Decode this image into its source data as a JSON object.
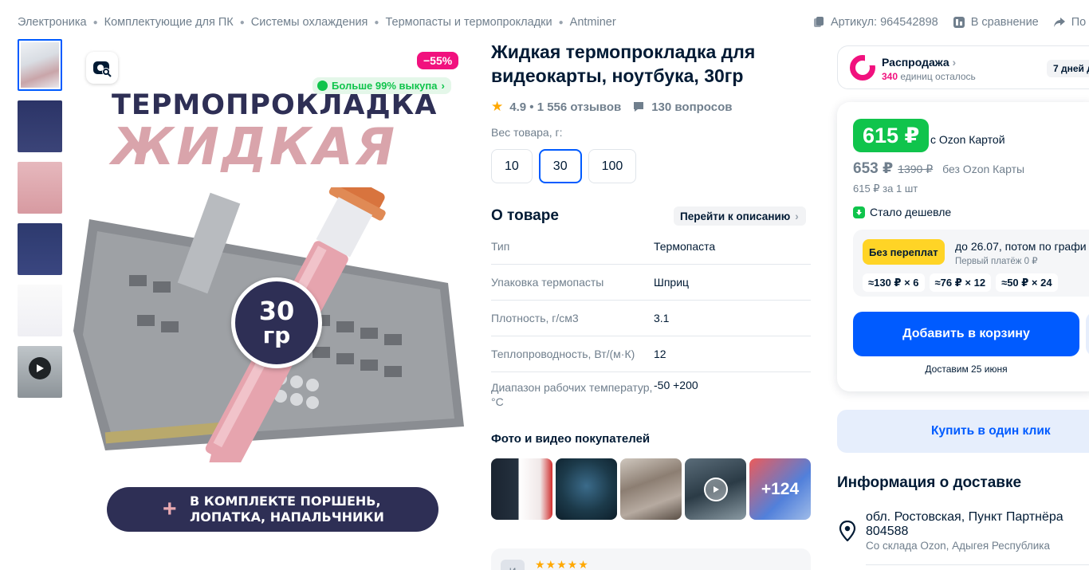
{
  "breadcrumb": [
    "Электроника",
    "Комплектующие для ПК",
    "Системы охлаждения",
    "Термопасты и термопрокладки",
    "Antminer"
  ],
  "top_actions": {
    "article": "Артикул: 964542898",
    "compare": "В сравнение",
    "share": "По"
  },
  "gallery": {
    "discount_badge": "−55%",
    "buyout_badge": "Больше 99% выкупа",
    "image_text": {
      "line1": "ТЕРМОПРОКЛАДКА",
      "line2": "ЖИДКАЯ",
      "badge_top": "30",
      "badge_bottom": "гр",
      "plus": "+",
      "bottom_line1": "В КОМПЛЕКТЕ ПОРШЕНЬ,",
      "bottom_line2": "ЛОПАТКА, НАПАЛЬЧНИКИ"
    }
  },
  "product": {
    "title": "Жидкая термопрокладка для видеокарты, ноутбука, 30гр",
    "rating": "4.9 • 1 556 отзывов",
    "questions": "130 вопросов",
    "weight_label": "Вес товара, г:",
    "weights": [
      "10",
      "30",
      "100"
    ],
    "selected_weight": "30"
  },
  "about": {
    "title": "О товаре",
    "to_description": "Перейти к описанию",
    "specs": [
      {
        "k": "Тип",
        "v": "Термопаста"
      },
      {
        "k": "Упаковка термопасты",
        "v": "Шприц"
      },
      {
        "k": "Плотность, г/см3",
        "v": "3.1"
      },
      {
        "k": "Теплопроводность, Вт/(м·К)",
        "v": "12"
      },
      {
        "k": "Диапазон рабочих температур, °С",
        "v": "-50 +200"
      }
    ]
  },
  "buyer_media": {
    "title": "Фото и видео покупателей",
    "more": "+124"
  },
  "sale": {
    "title": "Распродажа",
    "count": "340",
    "left_text": "единиц осталось",
    "days": "7 дней д"
  },
  "price": {
    "ozon_card_price": "615 ₽",
    "ozon_card_label": "с Ozon Картой",
    "price": "653 ₽",
    "old_price": "1390 ₽",
    "no_card_label": "без Ozon Карты",
    "unit_price": "615 ₽ за 1 шт",
    "cheaper": "Стало дешевле",
    "installment": {
      "badge": "Без переплат",
      "text": "до 26.07, потом по графи",
      "first_payment": "Первый платёж 0 ₽",
      "chips": [
        "≈130 ₽ × 6",
        "≈76 ₽ × 12",
        "≈50 ₽ × 24"
      ]
    },
    "add_to_cart": "Добавить в корзину",
    "deliver_date": "Доставим 25 июня"
  },
  "one_click": "Купить в один клик",
  "delivery": {
    "title": "Информация о доставке",
    "address": "обл. Ростовская, Пункт Партнёра 804588",
    "warehouse": "Со склада Ozon, Адыгея Республика"
  },
  "colors": {
    "ozon_blue": "#005bff",
    "ozon_green": "#10c44c",
    "ozon_pink": "#f1117e",
    "installment_yellow": "#ffd426"
  }
}
